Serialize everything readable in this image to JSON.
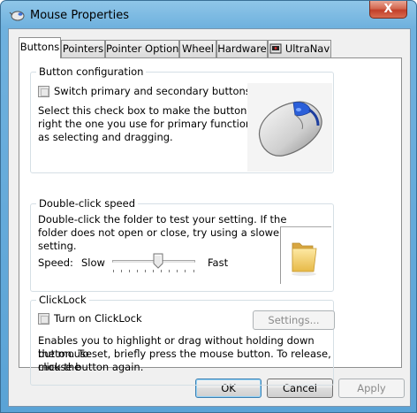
{
  "window": {
    "title": "Mouse Properties",
    "close_glyph": "X"
  },
  "tabs": [
    {
      "label": "Buttons",
      "active": true
    },
    {
      "label": "Pointers",
      "active": false
    },
    {
      "label": "Pointer Options",
      "active": false
    },
    {
      "label": "Wheel",
      "active": false
    },
    {
      "label": "Hardware",
      "active": false
    },
    {
      "label": "UltraNav",
      "active": false,
      "icon": "ultranav-icon"
    }
  ],
  "button_configuration": {
    "title": "Button configuration",
    "checkbox_label": "Switch primary and secondary buttons",
    "checked": false,
    "description_lines": [
      "Select this check box to make the button on the",
      "right the one you use for primary functions such",
      "as selecting and dragging."
    ],
    "image_icon": "mouse-icon"
  },
  "double_click": {
    "title": "Double-click speed",
    "description_lines": [
      "Double-click the folder to test your setting. If the",
      "folder does not open or close, try using a slower",
      "setting."
    ],
    "speed_label": "Speed:",
    "slow_label": "Slow",
    "fast_label": "Fast",
    "slider_value_fraction": 0.55,
    "folder_icon": "folder-icon"
  },
  "clicklock": {
    "title": "ClickLock",
    "checkbox_label": "Turn on ClickLock",
    "checked": false,
    "settings_button": "Settings...",
    "settings_enabled": false,
    "description_lines": [
      "Enables you to highlight or drag without holding down the mouse",
      "button. To set, briefly press the mouse button. To release, click the",
      "mouse button again."
    ]
  },
  "footer": {
    "ok": "OK",
    "cancel": "Cancel",
    "apply": "Apply",
    "apply_enabled": false
  },
  "colors": {
    "title_bar": "#6fb1de",
    "close_button": "#c2402a",
    "group_border": "#d5dfe5"
  }
}
